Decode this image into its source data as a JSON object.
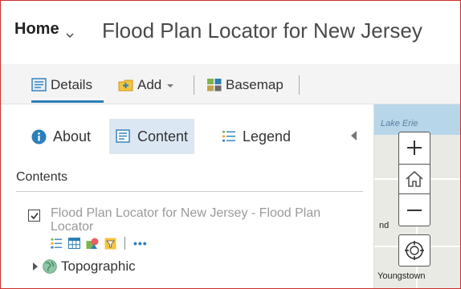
{
  "header": {
    "home_label": "Home",
    "title": "Flood Plan Locator for New Jersey"
  },
  "toolbar": {
    "details_label": "Details",
    "add_label": "Add",
    "basemap_label": "Basemap"
  },
  "tabs": {
    "about_label": "About",
    "content_label": "Content",
    "legend_label": "Legend"
  },
  "contents": {
    "heading": "Contents",
    "layers": [
      {
        "name": "Flood Plan Locator for New Jersey - Flood Plan Locator",
        "checked": true
      },
      {
        "name": "Topographic"
      }
    ],
    "more_label": "•••"
  },
  "map": {
    "lake_label": "Lake Erie",
    "place_partial": "nd",
    "place_youngstown": "Youngstown"
  },
  "colors": {
    "accent": "#2c7fb8",
    "frame_border": "#c9302c",
    "active_tab_bg": "#dbe8f3"
  },
  "icons": [
    "chevron-down-icon",
    "details-icon",
    "add-icon",
    "basemap-icon",
    "info-icon",
    "content-icon",
    "legend-icon",
    "collapse-icon",
    "checkbox-icon",
    "table-icon",
    "filter-icon",
    "styles-icon",
    "globe-icon",
    "zoom-in-icon",
    "home-icon",
    "zoom-out-icon",
    "locate-icon"
  ]
}
